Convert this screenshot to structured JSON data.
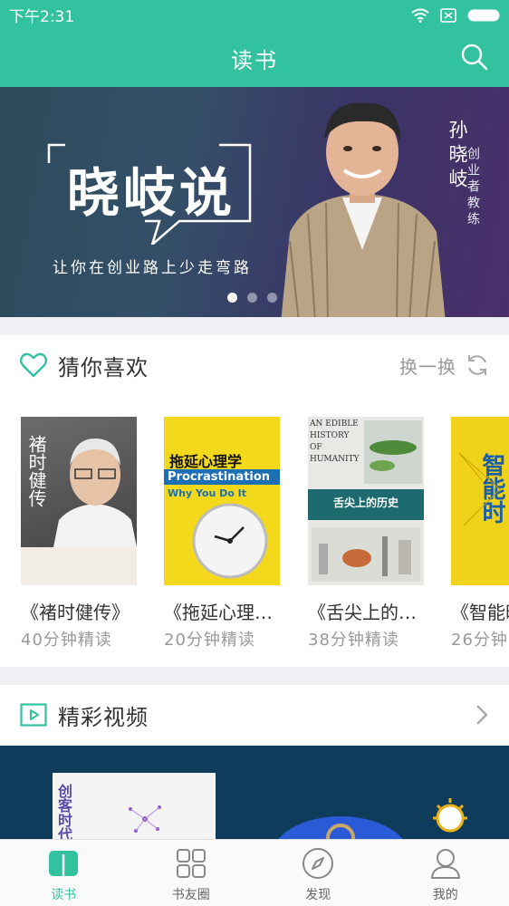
{
  "status": {
    "time": "下午2:31"
  },
  "nav": {
    "title": "读书"
  },
  "banner": {
    "title": "晓岐说",
    "slogan": "让你在创业路上少走弯路",
    "person_name": "孙晓岐",
    "person_role": "创业者教练",
    "page_count": 3,
    "active_page": 1
  },
  "guess": {
    "title": "猜你喜欢",
    "refresh_label": "换一换",
    "books": [
      {
        "title": "《褚时健传》",
        "meta": "40分钟精读",
        "cover_title": "褚时健传"
      },
      {
        "title": "《拖延心理…",
        "meta": "20分钟精读",
        "cover_title": "拖延心理学",
        "cover_subtitle": "Procrastination",
        "cover_subtitle2": "Why You Do It"
      },
      {
        "title": "《舌尖上的…",
        "meta": "38分钟精读",
        "cover_title": "舌尖上的历史",
        "cover_subtitle": "AN EDIBLE HISTORY OF HUMANITY"
      },
      {
        "title": "《智能时",
        "meta": "26分钟",
        "cover_title": "智能时"
      }
    ]
  },
  "video": {
    "title": "精彩视频",
    "cover_text": "创客时代"
  },
  "tabs": [
    {
      "label": "读书",
      "icon": "book-icon",
      "active": true
    },
    {
      "label": "书友圈",
      "icon": "grid-icon",
      "active": false
    },
    {
      "label": "发现",
      "icon": "compass-icon",
      "active": false
    },
    {
      "label": "我的",
      "icon": "user-icon",
      "active": false
    }
  ],
  "colors": {
    "accent": "#33c2a0",
    "text": "#333333",
    "muted": "#999999"
  }
}
